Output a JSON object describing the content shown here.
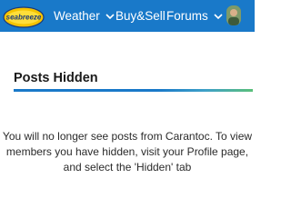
{
  "header": {
    "logo_alt": "seabreeze",
    "nav": [
      {
        "label": "Weather",
        "has_dropdown": true
      },
      {
        "label": "Buy&Sell",
        "has_dropdown": false
      },
      {
        "label": "Forums",
        "has_dropdown": true
      }
    ],
    "brand_color": "#1979c9"
  },
  "dialog": {
    "title": "Posts Hidden",
    "message_lines": [
      "You will no longer see posts from Carantoc. To view",
      "members you have hidden, visit your Profile page,",
      "and select the 'Hidden' tab"
    ]
  }
}
